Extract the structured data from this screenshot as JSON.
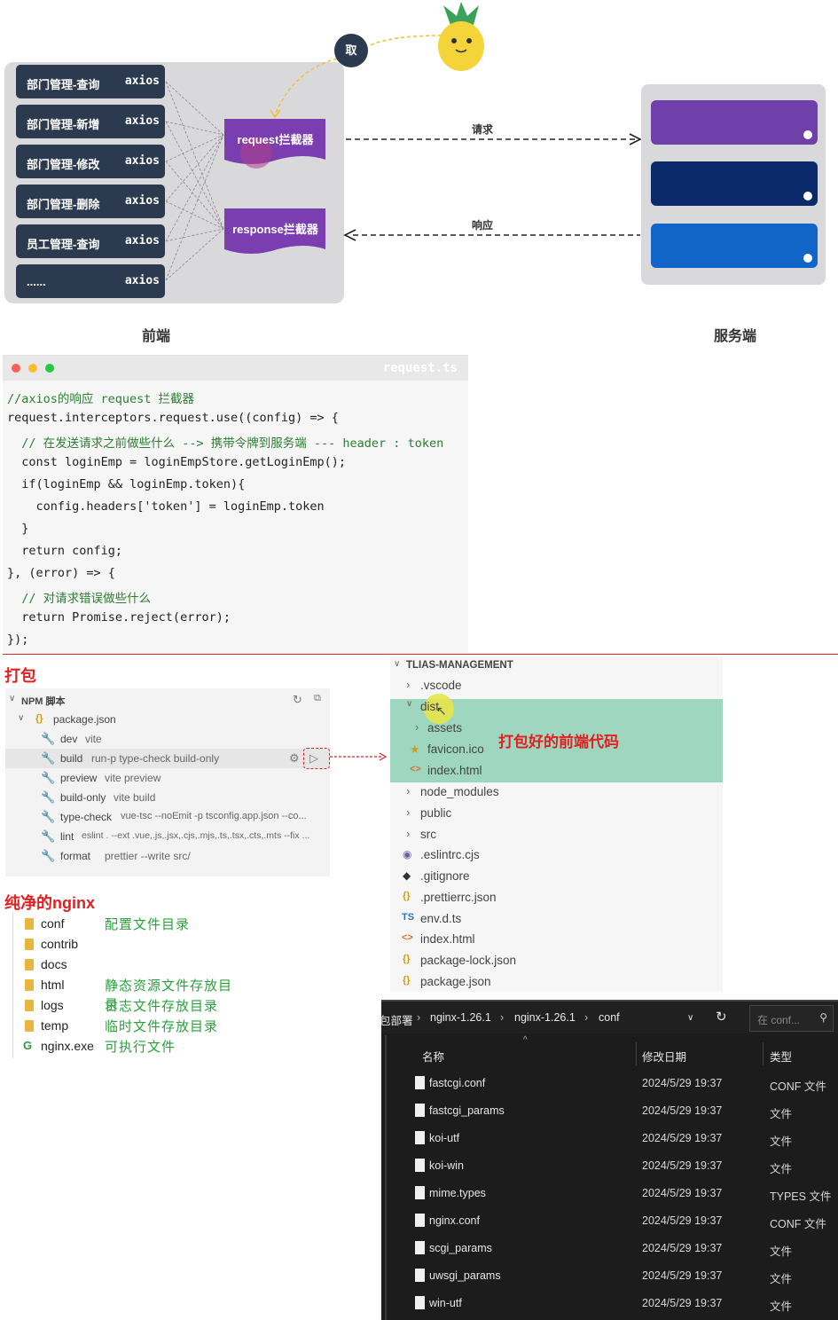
{
  "diagram": {
    "take_label": "取",
    "frontend_rows": [
      {
        "label": "部门管理-查询",
        "tag": "axios"
      },
      {
        "label": "部门管理-新增",
        "tag": "axios"
      },
      {
        "label": "部门管理-修改",
        "tag": "axios"
      },
      {
        "label": "部门管理-删除",
        "tag": "axios"
      },
      {
        "label": "员工管理-查询",
        "tag": "axios"
      },
      {
        "label": "......",
        "tag": "axios"
      }
    ],
    "request_interceptor": "request拦截器",
    "response_interceptor": "response拦截器",
    "request_arrow_label": "请求",
    "response_arrow_label": "响应",
    "frontend_caption": "前端",
    "server_caption": "服务端",
    "server_bar_colors": [
      "#7040aa",
      "#0a2a6b",
      "#1164c8"
    ]
  },
  "code": {
    "filename": "request.ts",
    "lines": [
      "//axios的响应 request 拦截器",
      "request.interceptors.request.use((config) => {",
      "  // 在发送请求之前做些什么 --> 携带令牌到服务端 --- header : token",
      "  const loginEmp = loginEmpStore.getLoginEmp();",
      "  if(loginEmp && loginEmp.token){",
      "    config.headers['token'] = loginEmp.token",
      "  }",
      "  return config;",
      "}, (error) => {",
      "  // 对请求错误做些什么",
      "  return Promise.reject(error);",
      "});"
    ]
  },
  "pack_title": "打包",
  "npm": {
    "header": "NPM 脚本",
    "package": "package.json",
    "scripts": [
      {
        "name": "dev",
        "cmd": "vite"
      },
      {
        "name": "build",
        "cmd": "run-p type-check build-only"
      },
      {
        "name": "preview",
        "cmd": "vite preview"
      },
      {
        "name": "build-only",
        "cmd": "vite build"
      },
      {
        "name": "type-check",
        "cmd": "vue-tsc --noEmit -p tsconfig.app.json --co..."
      },
      {
        "name": "lint",
        "cmd": "eslint . --ext .vue,.js,.jsx,.cjs,.mjs,.ts,.tsx,.cts,.mts --fix ..."
      },
      {
        "name": "format",
        "cmd": "prettier --write src/"
      }
    ]
  },
  "nginx_title": "纯净的nginx",
  "nginx": [
    {
      "name": "conf",
      "desc": "配置文件目录"
    },
    {
      "name": "contrib",
      "desc": ""
    },
    {
      "name": "docs",
      "desc": ""
    },
    {
      "name": "html",
      "desc": "静态资源文件存放目录"
    },
    {
      "name": "logs",
      "desc": "日志文件存放目录"
    },
    {
      "name": "temp",
      "desc": "临时文件存放目录"
    },
    {
      "name": "nginx.exe",
      "desc": "可执行文件"
    }
  ],
  "tree": {
    "root": "TLIAS-MANAGEMENT",
    "dist_note": "打包好的前端代码",
    "items": [
      {
        "label": ".vscode"
      },
      {
        "label": "dist"
      },
      {
        "label": "assets"
      },
      {
        "label": "favicon.ico"
      },
      {
        "label": "index.html"
      },
      {
        "label": "node_modules"
      },
      {
        "label": "public"
      },
      {
        "label": "src"
      },
      {
        "label": ".eslintrc.cjs"
      },
      {
        "label": ".gitignore"
      },
      {
        "label": ".prettierrc.json"
      },
      {
        "label": "env.d.ts"
      },
      {
        "label": "index.html"
      },
      {
        "label": "package-lock.json"
      },
      {
        "label": "package.json"
      }
    ]
  },
  "explorer": {
    "breadcrumb": [
      "包部署",
      "nginx-1.26.1",
      "nginx-1.26.1",
      "conf"
    ],
    "search_placeholder": "在 conf...",
    "columns": {
      "name": "名称",
      "date": "修改日期",
      "type": "类型"
    },
    "files": [
      {
        "name": "fastcgi.conf",
        "date": "2024/5/29 19:37",
        "type": "CONF 文件"
      },
      {
        "name": "fastcgi_params",
        "date": "2024/5/29 19:37",
        "type": "文件"
      },
      {
        "name": "koi-utf",
        "date": "2024/5/29 19:37",
        "type": "文件"
      },
      {
        "name": "koi-win",
        "date": "2024/5/29 19:37",
        "type": "文件"
      },
      {
        "name": "mime.types",
        "date": "2024/5/29 19:37",
        "type": "TYPES 文件"
      },
      {
        "name": "nginx.conf",
        "date": "2024/5/29 19:37",
        "type": "CONF 文件"
      },
      {
        "name": "scgi_params",
        "date": "2024/5/29 19:37",
        "type": "文件"
      },
      {
        "name": "uwsgi_params",
        "date": "2024/5/29 19:37",
        "type": "文件"
      },
      {
        "name": "win-utf",
        "date": "2024/5/29 19:37",
        "type": "文件"
      }
    ]
  }
}
